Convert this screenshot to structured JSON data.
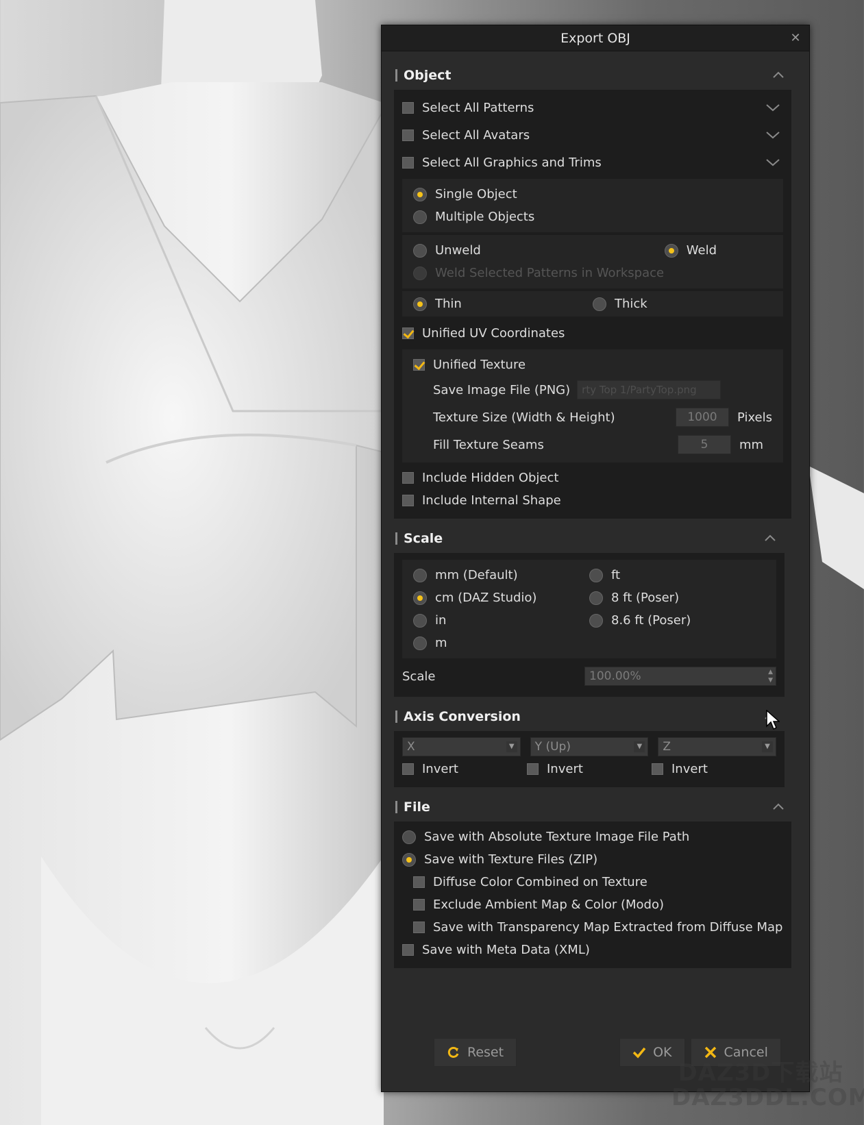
{
  "dialog": {
    "title": "Export OBJ"
  },
  "object": {
    "header": "Object",
    "select_rows": [
      {
        "label": "Select All Patterns",
        "checked": false
      },
      {
        "label": "Select All Avatars",
        "checked": false
      },
      {
        "label": "Select All Graphics and Trims",
        "checked": false
      }
    ],
    "object_mode": {
      "single": "Single Object",
      "multiple": "Multiple Objects",
      "selected": "single"
    },
    "weld": {
      "unweld": "Unweld",
      "weld": "Weld",
      "weld_selected": "Weld Selected Patterns in Workspace",
      "selected": "weld"
    },
    "thickness": {
      "thin": "Thin",
      "thick": "Thick",
      "selected": "thin"
    },
    "unified_uv": {
      "label": "Unified UV Coordinates",
      "checked": true
    },
    "texture": {
      "unified_label": "Unified Texture",
      "unified_checked": true,
      "save_image_label": "Save Image File (PNG)",
      "save_image_value": "rty Top 1/PartyTop.png",
      "size_label": "Texture Size (Width & Height)",
      "size_value": "1000",
      "size_unit": "Pixels",
      "seams_label": "Fill Texture Seams",
      "seams_value": "5",
      "seams_unit": "mm"
    },
    "include_hidden": {
      "label": "Include Hidden Object",
      "checked": false
    },
    "include_internal": {
      "label": "Include Internal Shape",
      "checked": false
    }
  },
  "scale": {
    "header": "Scale",
    "options_left": [
      "mm (Default)",
      "cm (DAZ Studio)",
      "in",
      "m"
    ],
    "options_right": [
      "ft",
      "8 ft (Poser)",
      "8.6 ft (Poser)"
    ],
    "selected": "cm (DAZ Studio)",
    "scale_label": "Scale",
    "scale_value": "100.00%"
  },
  "axis": {
    "header": "Axis Conversion",
    "axes": [
      {
        "value": "X",
        "invert_label": "Invert"
      },
      {
        "value": "Y (Up)",
        "invert_label": "Invert"
      },
      {
        "value": "Z",
        "invert_label": "Invert"
      }
    ]
  },
  "file": {
    "header": "File",
    "absolute_path": "Save with Absolute Texture Image File Path",
    "zip": "Save with Texture Files (ZIP)",
    "selected": "zip",
    "diffuse": "Diffuse Color Combined on Texture",
    "exclude_ambient": "Exclude Ambient Map & Color (Modo)",
    "transparency": "Save with Transparency Map Extracted from Diffuse Map",
    "meta": "Save with Meta Data (XML)"
  },
  "footer": {
    "reset": "Reset",
    "ok": "OK",
    "cancel": "Cancel"
  },
  "watermark": {
    "line1": "DAZ3D下载站",
    "line2": "DAZ3DDL.COM"
  },
  "colors": {
    "accent": "#f5c21a",
    "panel": "#2b2b2b",
    "panel_dark": "#1d1d1d"
  }
}
